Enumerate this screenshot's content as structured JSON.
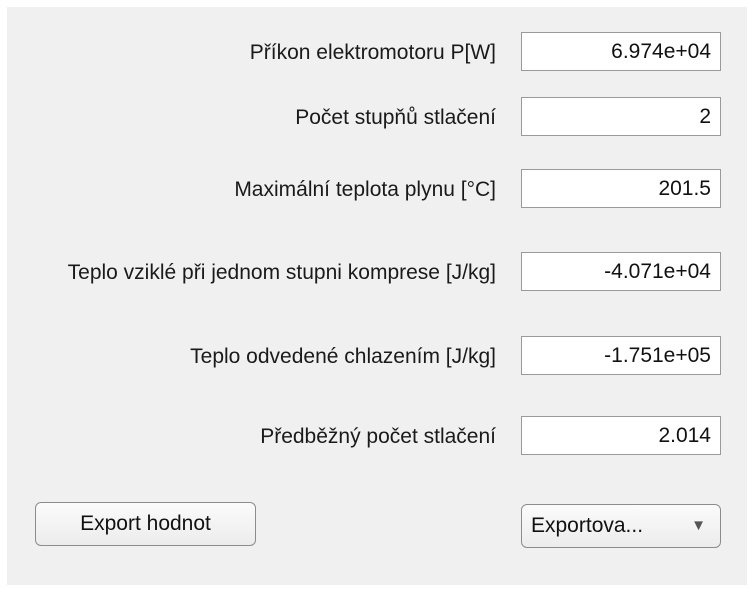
{
  "fields": [
    {
      "label": "Příkon elektromotoru P[W]",
      "value": "6.974e+04"
    },
    {
      "label": "Počet stupňů stlačení",
      "value": "2"
    },
    {
      "label": "Maximální teplota plynu [°C]",
      "value": "201.5"
    },
    {
      "label": "Teplo vziklé při jednom stupni komprese [J/kg]",
      "value": "-4.071e+04"
    },
    {
      "label": "Teplo odvedené chlazením [J/kg]",
      "value": "-1.751e+05"
    },
    {
      "label": "Předběžný počet stlačení",
      "value": "2.014"
    }
  ],
  "export_button": {
    "label": "Export hodnot"
  },
  "export_dropdown": {
    "selected": "Exportova...",
    "arrow_icon": "triangle-down-icon"
  }
}
